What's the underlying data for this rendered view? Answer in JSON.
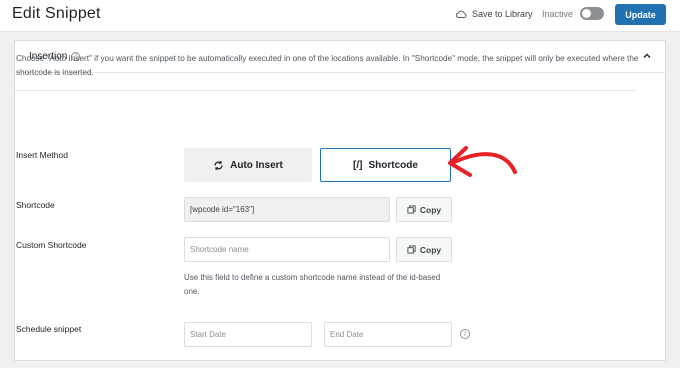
{
  "header": {
    "title": "Edit Snippet",
    "save_to_library": "Save to Library",
    "status_label": "Inactive",
    "update_label": "Update"
  },
  "panel": {
    "title": "Insertion",
    "description": "Choose \"Auto Insert\" if you want the snippet to be automatically executed in one of the locations available. In \"Shortcode\" mode, the snippet will only be executed where the shortcode is inserted.",
    "insert_method": {
      "label": "Insert Method",
      "auto_insert": "Auto Insert",
      "shortcode_icon": "[/]",
      "shortcode": "Shortcode",
      "selected": "Shortcode"
    },
    "shortcode": {
      "label": "Shortcode",
      "value": "[wpcode id=\"163\"]",
      "copy_label": "Copy"
    },
    "custom_shortcode": {
      "label": "Custom Shortcode",
      "placeholder": "Shortcode name",
      "copy_label": "Copy",
      "hint": "Use this field to define a custom shortcode name instead of the id-based one."
    },
    "schedule": {
      "label": "Schedule snippet",
      "start_placeholder": "Start Date",
      "end_placeholder": "End Date"
    }
  },
  "colors": {
    "accent": "#2271b1",
    "annotation": "#e62228"
  }
}
